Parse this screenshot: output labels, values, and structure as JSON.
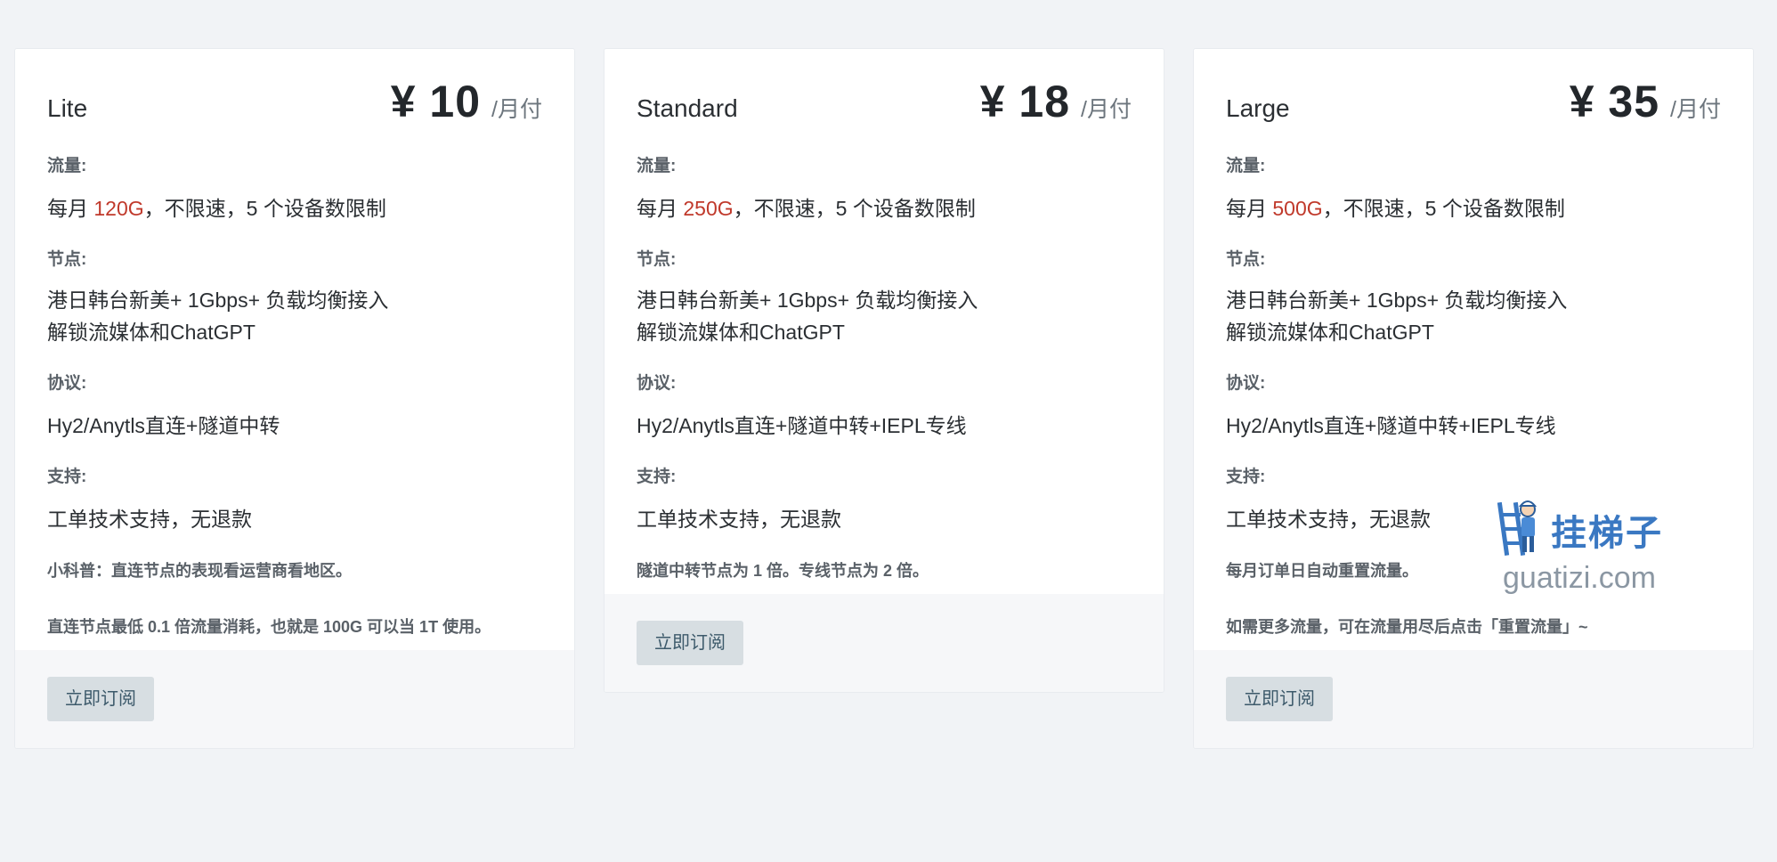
{
  "plans": [
    {
      "name": "Lite",
      "price": "¥ 10",
      "period": "/月付",
      "traffic_label": "流量:",
      "traffic_prefix": "每月 ",
      "traffic_amount": "120G",
      "traffic_suffix": "，不限速，5 个设备数限制",
      "nodes_label": "节点:",
      "nodes_line1": "港日韩台新美+ 1Gbps+ 负载均衡接入",
      "nodes_line2": "解锁流媒体和ChatGPT",
      "protocol_label": "协议:",
      "protocol": "Hy2/Anytls直连+隧道中转",
      "support_label": "支持:",
      "support": "工单技术支持，无退款",
      "note1": "小科普：直连节点的表现看运营商看地区。",
      "note2": "直连节点最低 0.1 倍流量消耗，也就是 100G 可以当 1T 使用。",
      "button": "立即订阅"
    },
    {
      "name": "Standard",
      "price": "¥ 18",
      "period": "/月付",
      "traffic_label": "流量:",
      "traffic_prefix": "每月 ",
      "traffic_amount": "250G",
      "traffic_suffix": "，不限速，5 个设备数限制",
      "nodes_label": "节点:",
      "nodes_line1": "港日韩台新美+ 1Gbps+ 负载均衡接入",
      "nodes_line2": "解锁流媒体和ChatGPT",
      "protocol_label": "协议:",
      "protocol": "Hy2/Anytls直连+隧道中转+IEPL专线",
      "support_label": "支持:",
      "support": "工单技术支持，无退款",
      "note1": "隧道中转节点为 1 倍。专线节点为 2 倍。",
      "button": "立即订阅"
    },
    {
      "name": "Large",
      "price": "¥ 35",
      "period": "/月付",
      "traffic_label": "流量:",
      "traffic_prefix": "每月 ",
      "traffic_amount": "500G",
      "traffic_suffix": "，不限速，5 个设备数限制",
      "nodes_label": "节点:",
      "nodes_line1": "港日韩台新美+ 1Gbps+ 负载均衡接入",
      "nodes_line2": "解锁流媒体和ChatGPT",
      "protocol_label": "协议:",
      "protocol": "Hy2/Anytls直连+隧道中转+IEPL专线",
      "support_label": "支持:",
      "support": "工单技术支持，无退款",
      "note1": "每月订单日自动重置流量。",
      "note2": "如需更多流量，可在流量用尽后点击「重置流量」~",
      "button": "立即订阅"
    }
  ],
  "watermark": {
    "brand": "挂梯子",
    "domain": "guatizi.com",
    "icon": "ladder-worker-icon"
  },
  "colors": {
    "highlight": "#c0392b",
    "button_bg": "#d7dee2",
    "page_bg": "#f1f3f6"
  }
}
